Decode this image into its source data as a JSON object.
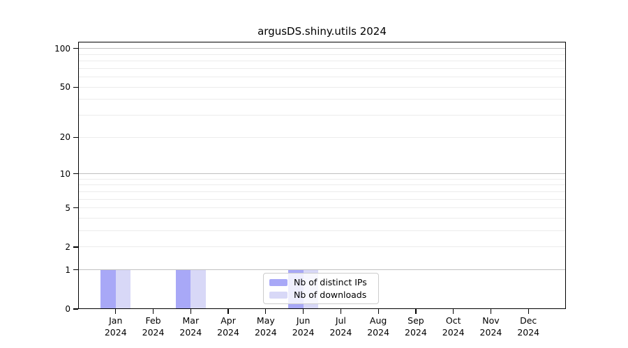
{
  "chart_data": {
    "type": "bar",
    "title": "argusDS.shiny.utils 2024",
    "xlabel": "",
    "ylabel": "",
    "categories": [
      "Jan",
      "Feb",
      "Mar",
      "Apr",
      "May",
      "Jun",
      "Jul",
      "Aug",
      "Sep",
      "Oct",
      "Nov",
      "Dec"
    ],
    "category_year": "2024",
    "series": [
      {
        "name": "Nb of distinct IPs",
        "color": "#a8a8f7",
        "values": [
          1,
          0,
          1,
          0,
          0,
          1,
          0,
          0,
          0,
          0,
          0,
          0
        ]
      },
      {
        "name": "Nb of downloads",
        "color": "#d8d8f7",
        "values": [
          1,
          0,
          1,
          0,
          0,
          1,
          0,
          0,
          0,
          0,
          0,
          0
        ]
      }
    ],
    "y_scale": "log1p",
    "ylim": [
      0,
      113
    ],
    "y_ticks": [
      0,
      1,
      2,
      5,
      10,
      20,
      50,
      100
    ],
    "y_gridlines_major": [
      1,
      10,
      100
    ],
    "y_gridlines_minor": [
      2,
      3,
      4,
      5,
      6,
      7,
      8,
      9,
      20,
      30,
      40,
      50,
      60,
      70,
      80,
      90
    ],
    "grid": true,
    "legend_position": "lower center inside"
  },
  "colors": {
    "background": "#ffffff",
    "axis": "#000000",
    "gridline_major": "#c0c0c0",
    "gridline_minor": "#ececec",
    "legend_border": "#cccccc"
  }
}
